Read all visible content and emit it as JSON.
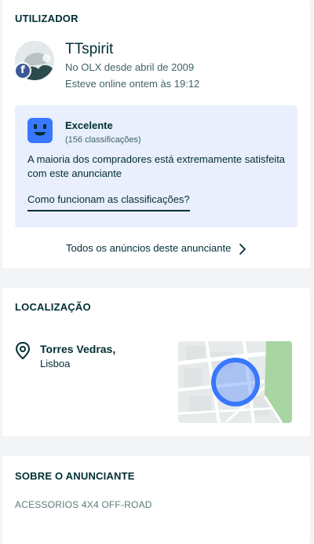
{
  "user_section": {
    "title": "UTILIZADOR",
    "username": "TTspirit",
    "member_since": "No OLX desde abril de 2009",
    "last_online": "Esteve online ontem às 19:12",
    "facebook_badge": "f",
    "rating": {
      "label": "Excelente",
      "count": "(156 classificações)",
      "description": "A maioria dos compradores está extremamente satisfeita com este anunciante",
      "link": "Como funcionam as classificações?",
      "icon": "smiley-icon"
    },
    "all_ads_link": "Todos os anúncios deste anunciante"
  },
  "location_section": {
    "title": "LOCALIZAÇÃO",
    "city": "Torres Vedras,",
    "region": "Lisboa",
    "icon": "location-pin-icon"
  },
  "about_section": {
    "title": "SOBRE O ANUNCIANTE",
    "text": "ACESSORIOS 4X4 OFF-ROAD"
  },
  "colors": {
    "primary_text": "#002f34",
    "secondary_text": "#406367",
    "rating_bg": "#e9effc",
    "accent_blue": "#3a77ff",
    "facebook": "#3b5998",
    "map_green": "#a8d5a2"
  }
}
